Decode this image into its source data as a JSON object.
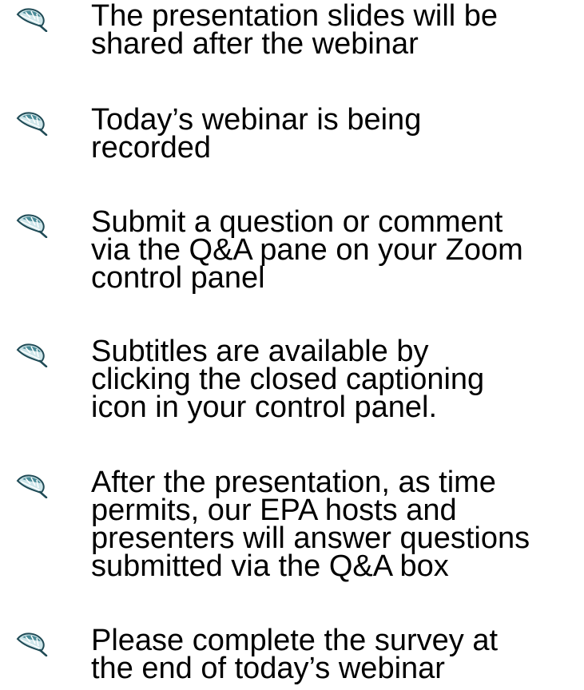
{
  "icon": {
    "name": "leaf-icon",
    "colors": {
      "dark": "#1f4a55",
      "mid": "#4a8c98",
      "light": "#cfe6ea",
      "vein": "#ffffff"
    }
  },
  "bullets": [
    {
      "text": "The presentation slides will be\nshared after the webinar"
    },
    {
      "text": "Today’s webinar is being\nrecorded"
    },
    {
      "text": "Submit a question or comment\nvia the Q&A pane on your Zoom\ncontrol panel"
    },
    {
      "text": "Subtitles are available by\nclicking the closed captioning\nicon in your control panel."
    },
    {
      "text": "After the presentation, as time\npermits, our EPA hosts and\npresenters will answer questions\nsubmitted via the Q&A box"
    },
    {
      "text": "Please complete the survey at\nthe end of today’s webinar"
    }
  ]
}
